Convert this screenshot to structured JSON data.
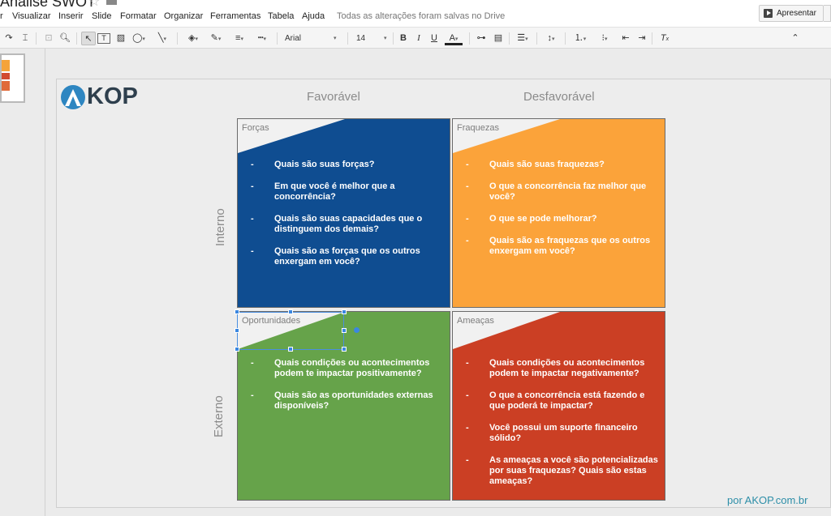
{
  "app": {
    "doc_title": "Análise SWOT",
    "menu": [
      "r",
      "Visualizar",
      "Inserir",
      "Slide",
      "Formatar",
      "Organizar",
      "Ferramentas",
      "Tabela",
      "Ajuda"
    ],
    "save_status": "Todas as alterações foram salvas no Drive",
    "present_label": "Apresentar"
  },
  "toolbar": {
    "font_name": "Arial",
    "font_size": "14",
    "bold": "B",
    "italic": "I",
    "underline": "U",
    "text_color": "A",
    "clear_format": "T"
  },
  "slide": {
    "logo_text": "KOP",
    "col_favoravel": "Favorável",
    "col_desfavoravel": "Desfavorável",
    "row_interno": "Interno",
    "row_externo": "Externo",
    "footer": "por AKOP.com.br",
    "quadrants": {
      "forcas": {
        "title": "Forças",
        "items": [
          "Quais são suas forças?",
          "Em que você é melhor que a concorrência?",
          "Quais são suas capacidades que o distinguem dos demais?",
          "Quais são as forças que os outros enxergam em você?"
        ]
      },
      "fraquezas": {
        "title": "Fraquezas",
        "items": [
          "Quais são suas fraquezas?",
          "O que a concorrência faz melhor que você?",
          "O que se pode melhorar?",
          "Quais são as fraquezas que os outros enxergam em você?"
        ]
      },
      "oportunidades": {
        "title": "Oportunidades",
        "items": [
          "Quais condições ou acontecimentos podem te impactar positivamente?",
          "Quais são as oportunidades externas disponíveis?"
        ]
      },
      "ameacas": {
        "title": "Ameaças",
        "items": [
          "Quais condições ou acontecimentos podem te impactar negativamente?",
          "O que a concorrência está fazendo e que poderá te impactar?",
          "Você possui um suporte financeiro sólido?",
          "As ameaças a você são potencializadas por suas fraquezas? Quais são estas ameaças?"
        ]
      }
    }
  },
  "colors": {
    "forcas": "#0f4d91",
    "fraquezas": "#fba33a",
    "oportunidades": "#66a34a",
    "ameacas": "#cb3f24",
    "accent": "#2d8ea8"
  }
}
